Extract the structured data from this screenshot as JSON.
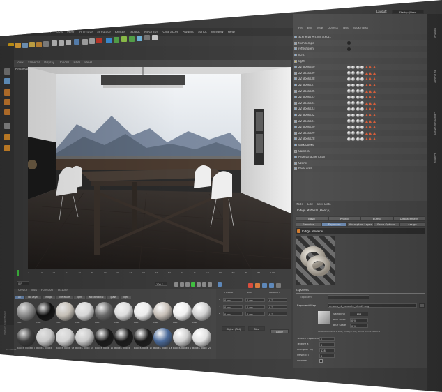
{
  "window": {
    "layout_label": "Layout:",
    "layout_value": "Startup (User)"
  },
  "main_menu": [
    "File",
    "Edit",
    "Create",
    "Select",
    "Tools",
    "Mesh",
    "Animate",
    "Simulate",
    "Render",
    "Sculpt",
    "MoGraph",
    "Character",
    "Plugins",
    "Script",
    "Window",
    "Help"
  ],
  "viewport": {
    "menu": [
      "View",
      "Cameras",
      "Display",
      "Options",
      "Filter",
      "Panel"
    ],
    "label": "Perspective"
  },
  "timeline": {
    "frame_field": "0 F",
    "end_field": "100 F",
    "start_field": "0 F",
    "ticks": [
      "0",
      "5",
      "10",
      "15",
      "20",
      "25",
      "30",
      "35",
      "40",
      "45",
      "50",
      "55",
      "60",
      "65",
      "70",
      "75",
      "80",
      "85",
      "90",
      "95",
      "100"
    ]
  },
  "material_manager": {
    "menu": [
      "Create",
      "Edit",
      "Function",
      "Texture"
    ],
    "filters": [
      "All",
      "No Layer",
      "indigo",
      "literature",
      "light",
      "architectural",
      "glass",
      "light"
    ],
    "row1_labels": [
      "Mat",
      "Mat",
      "Mat",
      "Mat",
      "Mat",
      "Mat",
      "Mat",
      "Mat",
      "Mat",
      "Mat"
    ],
    "row2_labels": [
      "Books_bookb_02",
      "Books_bookb_04",
      "Books_book_06",
      "Books_book_08",
      "Books_book_10",
      "Books_bookb_12",
      "Books_book_14",
      "Books_book_16",
      "Books_bookb_18",
      "Books_book_20"
    ],
    "side_label": "MAXON CINEMA 4D"
  },
  "coords": {
    "headers": [
      "Position",
      "Size",
      "Rotation"
    ],
    "axes": [
      "X",
      "Y",
      "Z"
    ],
    "values": [
      "0 cm",
      "0 cm",
      "0 cm",
      "0 cm",
      "0 cm",
      "0 cm",
      "0 °",
      "0 °",
      "0 °"
    ],
    "object_label": "Object (Rel)",
    "size_label": "Size",
    "apply": "Apply"
  },
  "object_manager": {
    "menu": [
      "File",
      "Edit",
      "View",
      "Objects",
      "Tags",
      "Bookmarks"
    ],
    "rows": [
      "Scene by Arthur Stecz..",
      "toch lampe",
      "reflektoren",
      "licht",
      "light",
      "22 Books40",
      "22 Books39",
      "22 Books38",
      "22 Books37",
      "22 Books36",
      "22 Books35",
      "22 Books34",
      "22 Books33",
      "22 Books32",
      "22 Books31",
      "22 Books30",
      "22 Books29",
      "22 Books28",
      "dark books",
      "Camera",
      "Arbeitsflachenchair",
      "Szene",
      "back wall"
    ]
  },
  "attribute_manager": {
    "menu": [
      "Mode",
      "Edit",
      "User Data"
    ],
    "title": "Indigo Material [Floor.p]",
    "tabs_row1": [
      "Basic",
      "Phong",
      "Bump",
      "Displacement"
    ],
    "tabs_row2": [
      "Emission",
      "Exponent",
      "Absorption Layer",
      "Extra Options",
      "Assign"
    ],
    "active_tab": "Exponent",
    "renderer_label": "Indigo renderer",
    "section": "Exponent",
    "exponent_label": "Exponent",
    "exponent_map_label": "Exponent Map",
    "file_name": "arnowa_ek_concrete_blend2.png",
    "sampling_label": "Sampling",
    "sampling_value": "MIP",
    "blur_offset_label": "Blur Offset",
    "blur_offset_value": "0 %",
    "blur_scale_label": "Blur Scale",
    "blur_scale_value": "0 %",
    "resolution": "Resolution 600 x 600, RGB (8 bit), sRGB IEC61966-2.1",
    "texture_exponent_label": "Texture Exponent",
    "texture_exponent_value": "0",
    "texture_a_label": "Texture a",
    "texture_a_value": "0",
    "multiplier_label": "Multiplier (k)",
    "multiplier_value": "128",
    "offset_label": "Offset (c)",
    "offset_value": "0",
    "smooth_label": "Smooth"
  },
  "side_tabs": [
    "Objects",
    "Structure",
    "Content Browser",
    "Layers"
  ],
  "status": "00:00:01"
}
